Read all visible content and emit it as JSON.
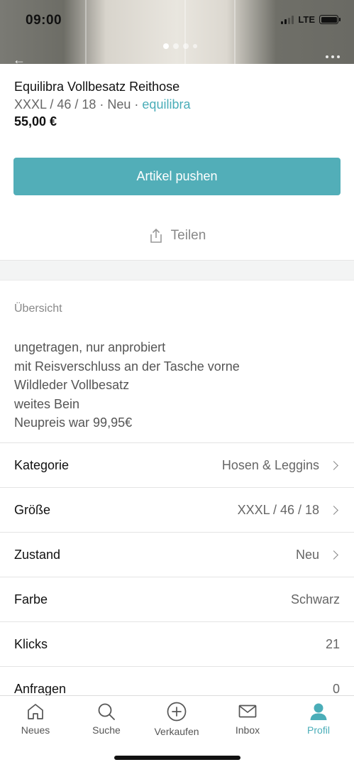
{
  "status_bar": {
    "time": "09:00",
    "network": "LTE"
  },
  "item": {
    "title": "Equilibra Vollbesatz Reithose",
    "size_condition": "XXXL / 46 / 18 · Neu · ",
    "brand": "equilibra",
    "price": "55,00 €"
  },
  "actions": {
    "push_label": "Artikel pushen",
    "share_label": "Teilen"
  },
  "overview": {
    "label": "Übersicht",
    "lines": [
      "ungetragen, nur anprobiert",
      "mit Reisverschluss an der Tasche vorne",
      "Wildleder Vollbesatz",
      "weites Bein",
      "Neupreis war 99,95€"
    ]
  },
  "details": [
    {
      "label": "Kategorie",
      "value": "Hosen & Leggins",
      "chevron": true
    },
    {
      "label": "Größe",
      "value": "XXXL / 46 / 18",
      "chevron": true
    },
    {
      "label": "Zustand",
      "value": "Neu",
      "chevron": true
    },
    {
      "label": "Farbe",
      "value": "Schwarz",
      "chevron": false
    },
    {
      "label": "Klicks",
      "value": "21",
      "chevron": false
    },
    {
      "label": "Anfragen",
      "value": "0",
      "chevron": false
    }
  ],
  "tabbar": {
    "items": [
      {
        "label": "Neues",
        "icon": "home-icon"
      },
      {
        "label": "Suche",
        "icon": "search-icon"
      },
      {
        "label": "Verkaufen",
        "icon": "plus-circle-icon"
      },
      {
        "label": "Inbox",
        "icon": "mail-icon"
      },
      {
        "label": "Profil",
        "icon": "user-icon"
      }
    ],
    "active": "Profil",
    "accent": "#4aadb8"
  }
}
